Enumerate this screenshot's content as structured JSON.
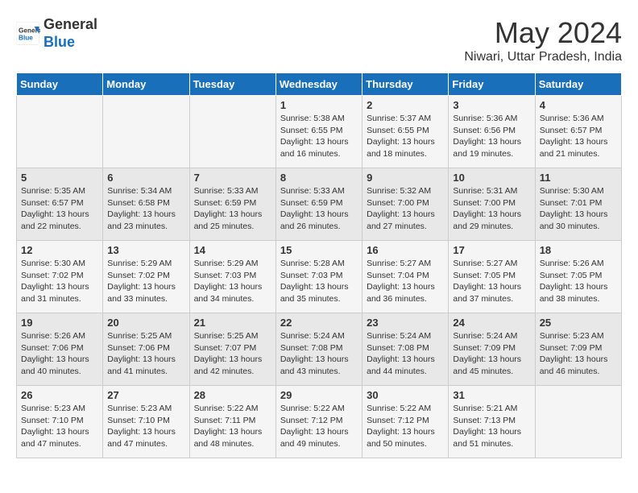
{
  "logo": {
    "line1": "General",
    "line2": "Blue"
  },
  "title": "May 2024",
  "location": "Niwari, Uttar Pradesh, India",
  "weekdays": [
    "Sunday",
    "Monday",
    "Tuesday",
    "Wednesday",
    "Thursday",
    "Friday",
    "Saturday"
  ],
  "weeks": [
    [
      {
        "day": "",
        "info": ""
      },
      {
        "day": "",
        "info": ""
      },
      {
        "day": "",
        "info": ""
      },
      {
        "day": "1",
        "info": "Sunrise: 5:38 AM\nSunset: 6:55 PM\nDaylight: 13 hours and 16 minutes."
      },
      {
        "day": "2",
        "info": "Sunrise: 5:37 AM\nSunset: 6:55 PM\nDaylight: 13 hours and 18 minutes."
      },
      {
        "day": "3",
        "info": "Sunrise: 5:36 AM\nSunset: 6:56 PM\nDaylight: 13 hours and 19 minutes."
      },
      {
        "day": "4",
        "info": "Sunrise: 5:36 AM\nSunset: 6:57 PM\nDaylight: 13 hours and 21 minutes."
      }
    ],
    [
      {
        "day": "5",
        "info": "Sunrise: 5:35 AM\nSunset: 6:57 PM\nDaylight: 13 hours and 22 minutes."
      },
      {
        "day": "6",
        "info": "Sunrise: 5:34 AM\nSunset: 6:58 PM\nDaylight: 13 hours and 23 minutes."
      },
      {
        "day": "7",
        "info": "Sunrise: 5:33 AM\nSunset: 6:59 PM\nDaylight: 13 hours and 25 minutes."
      },
      {
        "day": "8",
        "info": "Sunrise: 5:33 AM\nSunset: 6:59 PM\nDaylight: 13 hours and 26 minutes."
      },
      {
        "day": "9",
        "info": "Sunrise: 5:32 AM\nSunset: 7:00 PM\nDaylight: 13 hours and 27 minutes."
      },
      {
        "day": "10",
        "info": "Sunrise: 5:31 AM\nSunset: 7:00 PM\nDaylight: 13 hours and 29 minutes."
      },
      {
        "day": "11",
        "info": "Sunrise: 5:30 AM\nSunset: 7:01 PM\nDaylight: 13 hours and 30 minutes."
      }
    ],
    [
      {
        "day": "12",
        "info": "Sunrise: 5:30 AM\nSunset: 7:02 PM\nDaylight: 13 hours and 31 minutes."
      },
      {
        "day": "13",
        "info": "Sunrise: 5:29 AM\nSunset: 7:02 PM\nDaylight: 13 hours and 33 minutes."
      },
      {
        "day": "14",
        "info": "Sunrise: 5:29 AM\nSunset: 7:03 PM\nDaylight: 13 hours and 34 minutes."
      },
      {
        "day": "15",
        "info": "Sunrise: 5:28 AM\nSunset: 7:03 PM\nDaylight: 13 hours and 35 minutes."
      },
      {
        "day": "16",
        "info": "Sunrise: 5:27 AM\nSunset: 7:04 PM\nDaylight: 13 hours and 36 minutes."
      },
      {
        "day": "17",
        "info": "Sunrise: 5:27 AM\nSunset: 7:05 PM\nDaylight: 13 hours and 37 minutes."
      },
      {
        "day": "18",
        "info": "Sunrise: 5:26 AM\nSunset: 7:05 PM\nDaylight: 13 hours and 38 minutes."
      }
    ],
    [
      {
        "day": "19",
        "info": "Sunrise: 5:26 AM\nSunset: 7:06 PM\nDaylight: 13 hours and 40 minutes."
      },
      {
        "day": "20",
        "info": "Sunrise: 5:25 AM\nSunset: 7:06 PM\nDaylight: 13 hours and 41 minutes."
      },
      {
        "day": "21",
        "info": "Sunrise: 5:25 AM\nSunset: 7:07 PM\nDaylight: 13 hours and 42 minutes."
      },
      {
        "day": "22",
        "info": "Sunrise: 5:24 AM\nSunset: 7:08 PM\nDaylight: 13 hours and 43 minutes."
      },
      {
        "day": "23",
        "info": "Sunrise: 5:24 AM\nSunset: 7:08 PM\nDaylight: 13 hours and 44 minutes."
      },
      {
        "day": "24",
        "info": "Sunrise: 5:24 AM\nSunset: 7:09 PM\nDaylight: 13 hours and 45 minutes."
      },
      {
        "day": "25",
        "info": "Sunrise: 5:23 AM\nSunset: 7:09 PM\nDaylight: 13 hours and 46 minutes."
      }
    ],
    [
      {
        "day": "26",
        "info": "Sunrise: 5:23 AM\nSunset: 7:10 PM\nDaylight: 13 hours and 47 minutes."
      },
      {
        "day": "27",
        "info": "Sunrise: 5:23 AM\nSunset: 7:10 PM\nDaylight: 13 hours and 47 minutes."
      },
      {
        "day": "28",
        "info": "Sunrise: 5:22 AM\nSunset: 7:11 PM\nDaylight: 13 hours and 48 minutes."
      },
      {
        "day": "29",
        "info": "Sunrise: 5:22 AM\nSunset: 7:12 PM\nDaylight: 13 hours and 49 minutes."
      },
      {
        "day": "30",
        "info": "Sunrise: 5:22 AM\nSunset: 7:12 PM\nDaylight: 13 hours and 50 minutes."
      },
      {
        "day": "31",
        "info": "Sunrise: 5:21 AM\nSunset: 7:13 PM\nDaylight: 13 hours and 51 minutes."
      },
      {
        "day": "",
        "info": ""
      }
    ]
  ]
}
